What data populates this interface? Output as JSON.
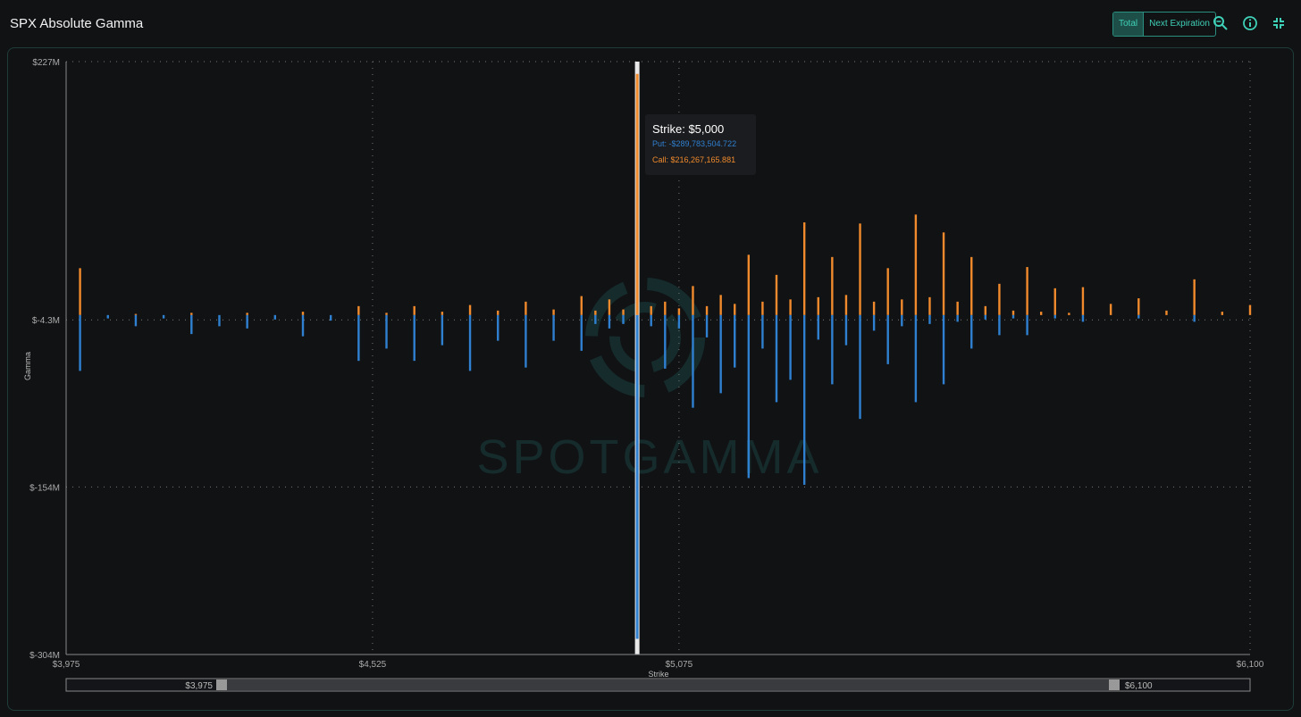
{
  "header": {
    "title": "SPX Absolute Gamma",
    "toggle": [
      "Total",
      "Next Expiration"
    ],
    "active_toggle": "Total",
    "icons": [
      "zoom-icon",
      "info-icon",
      "collapse-icon"
    ]
  },
  "colors": {
    "call": "#f08a2c",
    "put": "#2f80d0",
    "accent": "#3fd1b8",
    "background": "#111214"
  },
  "watermark": "SPOTGAMMA",
  "tooltip": {
    "strike": "Strike: $5,000",
    "put": "Put: -$289,783,504.722",
    "call": "Call: $216,267,165.881"
  },
  "slider": {
    "min_label": "$3,975",
    "max_label": "$6,100"
  },
  "chart_data": {
    "type": "bar",
    "title": "SPX Absolute Gamma",
    "xlabel": "Strike",
    "ylabel": "Gamma",
    "xlim": [
      3975,
      6100
    ],
    "ylim": [
      -304,
      227
    ],
    "unit": "M",
    "x_ticks": [
      3975,
      4525,
      5075,
      6100
    ],
    "x_tick_labels": [
      "$3,975",
      "$4,525",
      "$5,075",
      "$6,100"
    ],
    "y_ticks": [
      227,
      -4.3,
      -154,
      -304
    ],
    "y_tick_labels": [
      "$227M",
      "$-4.3M",
      "$-154M",
      "$-304M"
    ],
    "grid": true,
    "highlighted_strike": 5000,
    "series": [
      {
        "name": "Call",
        "points": [
          [
            4000,
            42
          ],
          [
            4100,
            1
          ],
          [
            4200,
            2
          ],
          [
            4300,
            2
          ],
          [
            4400,
            3
          ],
          [
            4500,
            8
          ],
          [
            4550,
            2
          ],
          [
            4600,
            8
          ],
          [
            4650,
            3
          ],
          [
            4700,
            9
          ],
          [
            4750,
            4
          ],
          [
            4800,
            12
          ],
          [
            4850,
            5
          ],
          [
            4900,
            17
          ],
          [
            4925,
            4
          ],
          [
            4950,
            14
          ],
          [
            4975,
            5
          ],
          [
            5000,
            216
          ],
          [
            5025,
            8
          ],
          [
            5050,
            12
          ],
          [
            5075,
            6
          ],
          [
            5100,
            26
          ],
          [
            5125,
            8
          ],
          [
            5150,
            18
          ],
          [
            5175,
            10
          ],
          [
            5200,
            54
          ],
          [
            5225,
            12
          ],
          [
            5250,
            36
          ],
          [
            5275,
            14
          ],
          [
            5300,
            83
          ],
          [
            5325,
            16
          ],
          [
            5350,
            52
          ],
          [
            5375,
            18
          ],
          [
            5400,
            82
          ],
          [
            5425,
            12
          ],
          [
            5450,
            42
          ],
          [
            5475,
            14
          ],
          [
            5500,
            90
          ],
          [
            5525,
            16
          ],
          [
            5550,
            74
          ],
          [
            5575,
            12
          ],
          [
            5600,
            52
          ],
          [
            5625,
            8
          ],
          [
            5650,
            28
          ],
          [
            5675,
            4
          ],
          [
            5700,
            43
          ],
          [
            5725,
            3
          ],
          [
            5750,
            24
          ],
          [
            5775,
            2
          ],
          [
            5800,
            25
          ],
          [
            5850,
            10
          ],
          [
            5900,
            15
          ],
          [
            5950,
            4
          ],
          [
            6000,
            32
          ],
          [
            6050,
            3
          ],
          [
            6100,
            9
          ]
        ]
      },
      {
        "name": "Put",
        "points": [
          [
            4000,
            -50
          ],
          [
            4050,
            -3
          ],
          [
            4100,
            -10
          ],
          [
            4150,
            -3
          ],
          [
            4200,
            -17
          ],
          [
            4250,
            -10
          ],
          [
            4300,
            -12
          ],
          [
            4350,
            -4
          ],
          [
            4400,
            -19
          ],
          [
            4450,
            -5
          ],
          [
            4500,
            -41
          ],
          [
            4550,
            -30
          ],
          [
            4600,
            -41
          ],
          [
            4650,
            -27
          ],
          [
            4700,
            -50
          ],
          [
            4750,
            -23
          ],
          [
            4800,
            -47
          ],
          [
            4850,
            -23
          ],
          [
            4900,
            -32
          ],
          [
            4925,
            -8
          ],
          [
            4950,
            -12
          ],
          [
            4975,
            -8
          ],
          [
            5000,
            -290
          ],
          [
            5025,
            -10
          ],
          [
            5050,
            -48
          ],
          [
            5075,
            -12
          ],
          [
            5100,
            -83
          ],
          [
            5125,
            -20
          ],
          [
            5150,
            -70
          ],
          [
            5175,
            -47
          ],
          [
            5200,
            -146
          ],
          [
            5225,
            -30
          ],
          [
            5250,
            -78
          ],
          [
            5275,
            -58
          ],
          [
            5300,
            -152
          ],
          [
            5325,
            -22
          ],
          [
            5350,
            -62
          ],
          [
            5375,
            -27
          ],
          [
            5400,
            -93
          ],
          [
            5425,
            -14
          ],
          [
            5450,
            -44
          ],
          [
            5475,
            -10
          ],
          [
            5500,
            -78
          ],
          [
            5525,
            -8
          ],
          [
            5550,
            -62
          ],
          [
            5575,
            -6
          ],
          [
            5600,
            -30
          ],
          [
            5625,
            -4
          ],
          [
            5650,
            -18
          ],
          [
            5675,
            -3
          ],
          [
            5700,
            -18
          ],
          [
            5750,
            -3
          ],
          [
            5800,
            -6
          ],
          [
            5900,
            -3
          ],
          [
            6000,
            -6
          ]
        ]
      }
    ]
  }
}
